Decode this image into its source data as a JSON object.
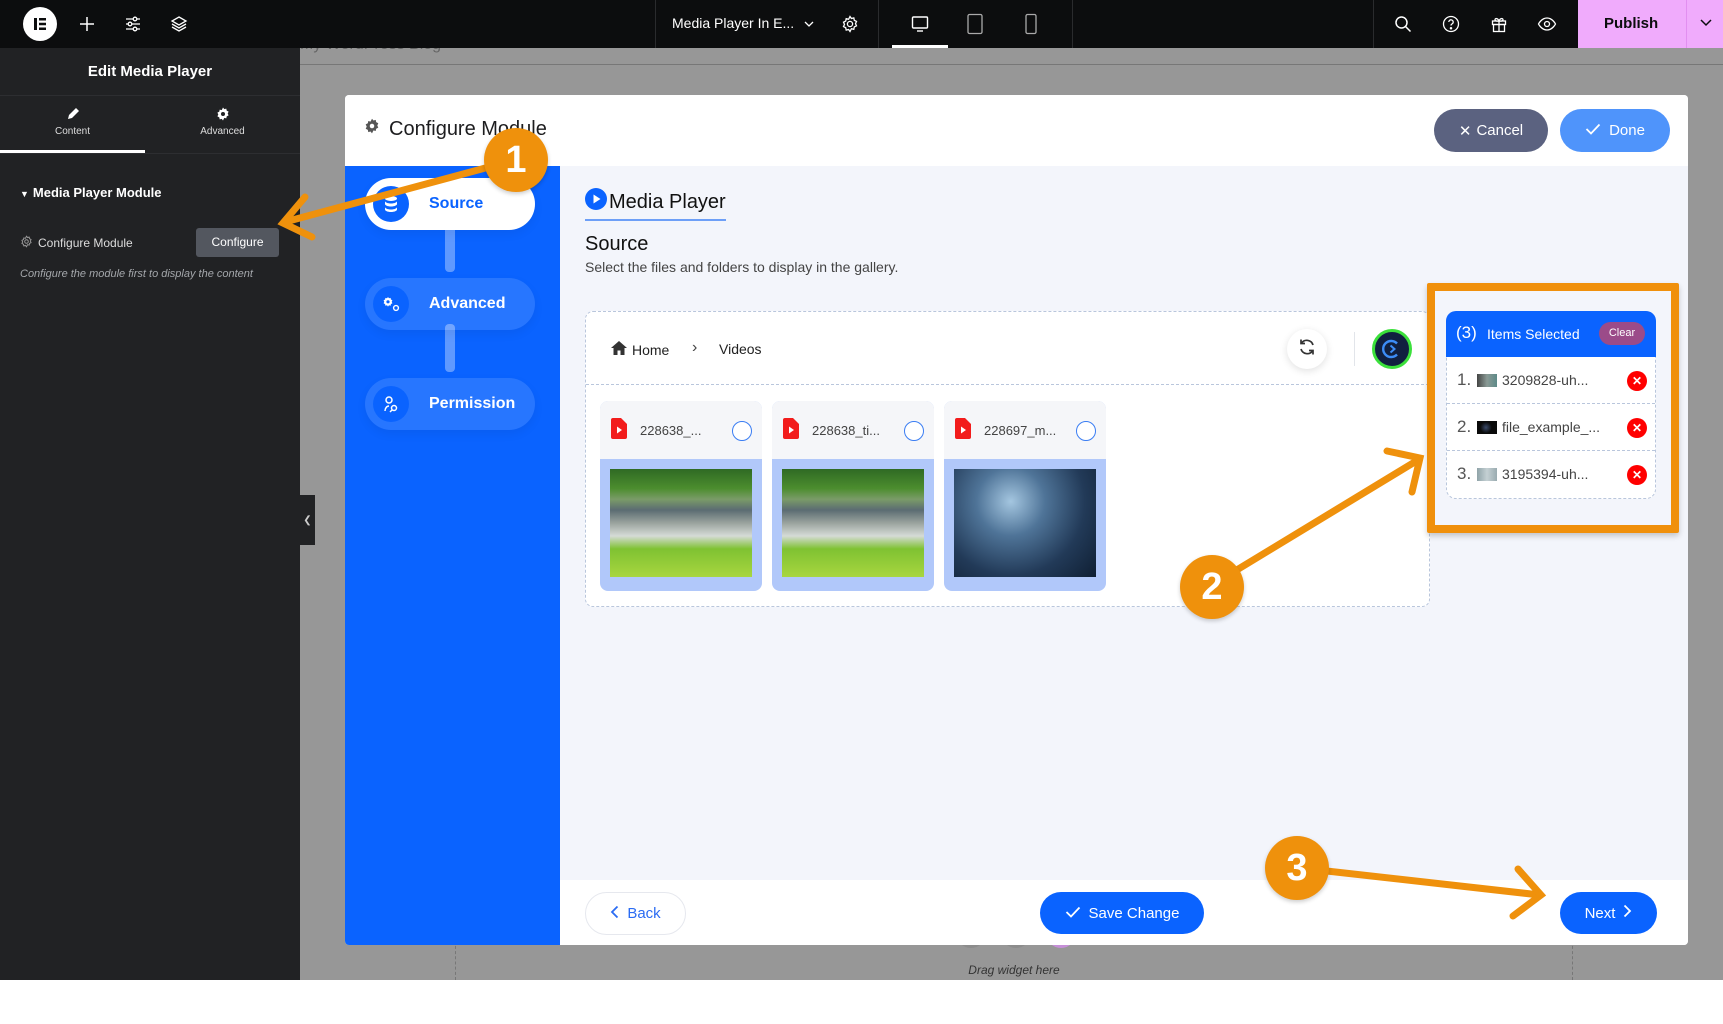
{
  "topbar": {
    "page_title": "Media Player In E...",
    "publish_label": "Publish",
    "icons": [
      "elementor-logo-icon",
      "plus-icon",
      "sliders-icon",
      "layers-icon",
      "chevron-down-icon",
      "gear-icon",
      "desktop-icon",
      "tablet-icon",
      "mobile-icon",
      "search-icon",
      "help-icon",
      "gift-icon",
      "eye-icon"
    ]
  },
  "left_panel": {
    "title": "Edit Media Player",
    "tabs": [
      {
        "label": "Content",
        "icon": "pencil-icon",
        "active": true
      },
      {
        "label": "Advanced",
        "icon": "gear-icon",
        "active": false
      }
    ],
    "section_title": "Media Player Module",
    "configure_label": "Configure Module",
    "configure_button": "Configure",
    "hint": "Configure the module first to display the content"
  },
  "canvas": {
    "background_text": "My WordPress Blog",
    "drag_text": "Drag widget here"
  },
  "modal": {
    "title": "Configure Module",
    "cancel_label": "Cancel",
    "done_label": "Done",
    "nav": [
      {
        "label": "Source",
        "icon": "database-icon",
        "active": true
      },
      {
        "label": "Advanced",
        "icon": "gears-icon",
        "active": false
      },
      {
        "label": "Permission",
        "icon": "user-key-icon",
        "active": false
      }
    ],
    "module_name": "Media Player",
    "section_title": "Source",
    "section_subtitle": "Select the files and folders to display in the gallery.",
    "breadcrumb": {
      "home": "Home",
      "current": "Videos"
    },
    "files": [
      {
        "name": "228638_...",
        "thumb": "river"
      },
      {
        "name": "228638_ti...",
        "thumb": "river"
      },
      {
        "name": "228697_m...",
        "thumb": "water"
      }
    ],
    "selection": {
      "count": "(3)",
      "label": "Items Selected",
      "clear_label": "Clear",
      "items": [
        {
          "num": "1.",
          "name": "3209828-uh...",
          "thumb": "people"
        },
        {
          "num": "2.",
          "name": "file_example_...",
          "thumb": "dark"
        },
        {
          "num": "3.",
          "name": "3195394-uh...",
          "thumb": "gray"
        }
      ]
    },
    "footer": {
      "back_label": "Back",
      "save_label": "Save Change",
      "next_label": "Next"
    }
  },
  "annotations": [
    {
      "number": "1",
      "target": "configure-button"
    },
    {
      "number": "2",
      "target": "selected-items-panel"
    },
    {
      "number": "3",
      "target": "next-button"
    }
  ],
  "colors": {
    "accent": "#0a63ff",
    "annotation": "#ef910c",
    "publish": "#f0abfc",
    "remove": "#ff0000",
    "clear": "#9b4b89"
  }
}
